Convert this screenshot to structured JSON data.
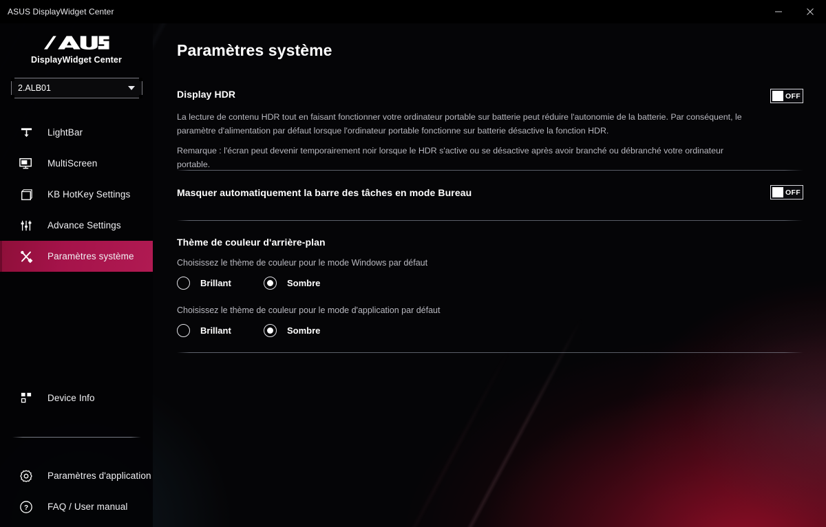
{
  "window": {
    "title": "ASUS DisplayWidget Center",
    "minimize_label": "–",
    "close_label": "✕"
  },
  "sidebar": {
    "brand_logo": "asus-logo",
    "brand_subtitle": "DisplayWidget Center",
    "device_select": {
      "value": "2.ALB01",
      "caret_icon": "chevron-down-icon"
    },
    "items": [
      {
        "label": "LightBar",
        "icon": "lightbar-icon",
        "active": false
      },
      {
        "label": "MultiScreen",
        "icon": "monitor-icon",
        "active": false
      },
      {
        "label": "KB HotKey Settings",
        "icon": "keyboard-square-icon",
        "active": false
      },
      {
        "label": "Advance Settings",
        "icon": "sliders-icon",
        "active": false
      },
      {
        "label": "Paramètres système",
        "icon": "tools-icon",
        "active": true
      }
    ],
    "bottom_items": [
      {
        "label": "Device Info",
        "icon": "device-info-icon"
      },
      {
        "label": "Paramètres d'application",
        "icon": "gear-icon"
      },
      {
        "label": "FAQ / User manual",
        "icon": "question-circle-icon"
      }
    ]
  },
  "main": {
    "page_title": "Paramètres système",
    "hdr": {
      "title": "Display HDR",
      "paragraph_1": "La lecture de contenu HDR tout en faisant fonctionner votre ordinateur portable sur batterie peut réduire l'autonomie de la batterie. Par conséquent, le paramètre d'alimentation par défaut lorsque l'ordinateur portable fonctionne sur batterie désactive la fonction HDR.",
      "paragraph_2": "Remarque : l'écran peut devenir temporairement noir lorsque le HDR s'active ou se désactive après avoir branché ou débranché votre ordinateur portable.",
      "toggle_state": "OFF"
    },
    "taskbar": {
      "title": "Masquer automatiquement la barre des tâches en mode Bureau",
      "toggle_state": "OFF"
    },
    "theme": {
      "title": "Thème de couleur d'arrière-plan",
      "windows_mode": {
        "description": "Choisissez le thème de couleur pour le mode Windows par défaut",
        "options": [
          {
            "label": "Brillant",
            "selected": false
          },
          {
            "label": "Sombre",
            "selected": true
          }
        ]
      },
      "app_mode": {
        "description": "Choisissez le thème de couleur pour le mode d'application par défaut",
        "options": [
          {
            "label": "Brillant",
            "selected": false
          },
          {
            "label": "Sombre",
            "selected": true
          }
        ]
      }
    }
  },
  "colors": {
    "accent": "#a5134a",
    "background": "#050507",
    "text_primary": "#ffffff",
    "text_secondary": "#b9b9c0",
    "glow_red": "#960e28"
  }
}
